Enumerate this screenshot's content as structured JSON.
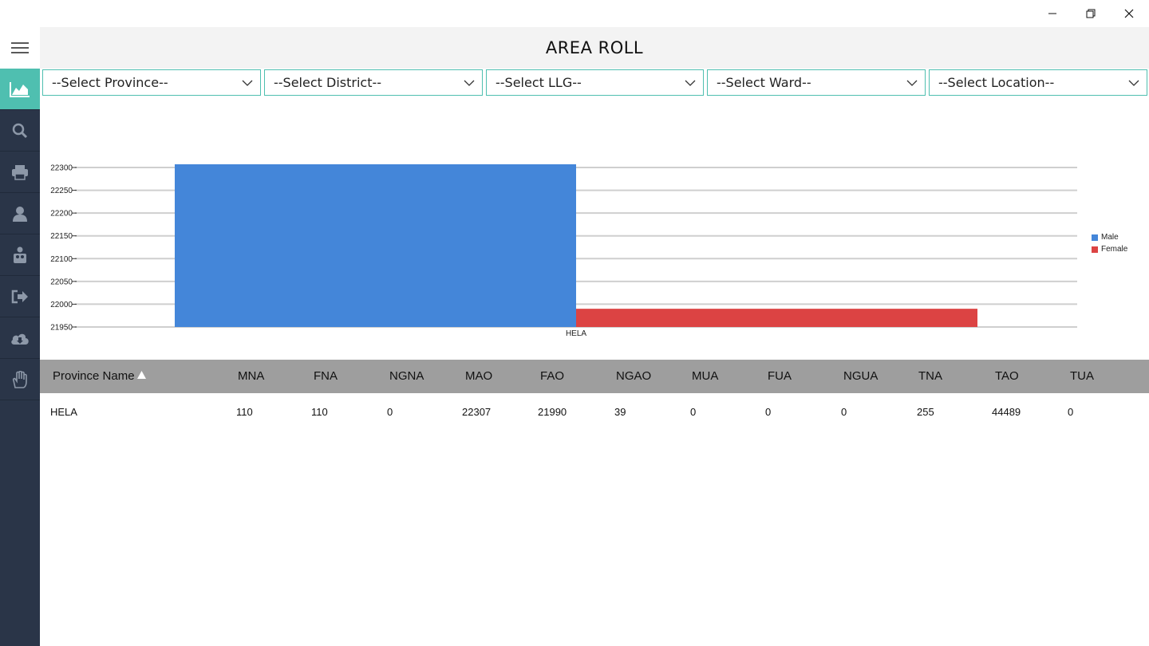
{
  "window": {
    "controls": [
      "minimize-icon",
      "restore-icon",
      "close-icon"
    ]
  },
  "header": {
    "title": "AREA ROLL"
  },
  "sidebar": {
    "items": [
      {
        "icon": "area-chart-icon",
        "active": true
      },
      {
        "icon": "search-icon",
        "active": false
      },
      {
        "icon": "printer-icon",
        "active": false
      },
      {
        "icon": "user-icon",
        "active": false
      },
      {
        "icon": "users-group-icon",
        "active": false
      },
      {
        "icon": "sign-out-icon",
        "active": false
      },
      {
        "icon": "cloud-download-icon",
        "active": false
      },
      {
        "icon": "hand-icon",
        "active": false
      }
    ]
  },
  "filters": {
    "province": "--Select Province--",
    "district": "--Select District--",
    "llg": "--Select LLG--",
    "ward": "--Select Ward--",
    "location": "--Select Location--"
  },
  "chart_data": {
    "type": "bar",
    "categories": [
      "HELA"
    ],
    "series": [
      {
        "name": "Male",
        "values": [
          22307
        ],
        "color": "#4486d9"
      },
      {
        "name": "Female",
        "values": [
          21990
        ],
        "color": "#dc4343"
      }
    ],
    "ylim": [
      21950,
      22300
    ],
    "yticks": [
      "22300",
      "22250",
      "22200",
      "22150",
      "22100",
      "22050",
      "22000",
      "21950"
    ],
    "grid": true,
    "legend": "right"
  },
  "table": {
    "columns": [
      "Province Name",
      "MNA",
      "FNA",
      "NGNA",
      "MAO",
      "FAO",
      "NGAO",
      "MUA",
      "FUA",
      "NGUA",
      "TNA",
      "TAO",
      "TUA"
    ],
    "rows": [
      [
        "HELA",
        "110",
        "110",
        "0",
        "22307",
        "21990",
        "39",
        "0",
        "0",
        "0",
        "255",
        "44489",
        "0"
      ]
    ]
  }
}
